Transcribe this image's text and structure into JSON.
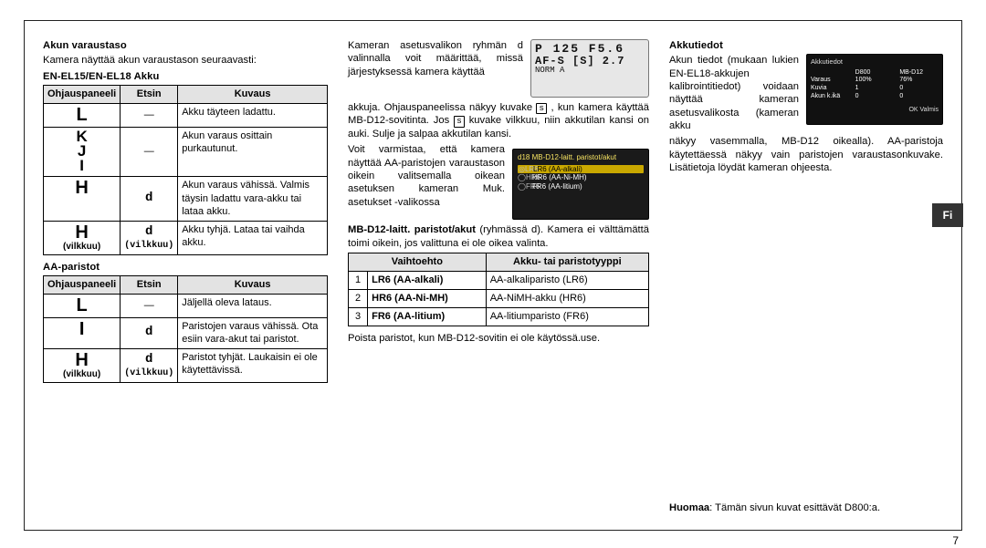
{
  "meta": {
    "page_number": "7",
    "lang_tab": "Fi"
  },
  "col1": {
    "h_level": "Akun varaustaso",
    "level_text": "Kamera näyttää akun varaustason seuraavasti:",
    "h_en": "EN-EL15/EN-EL18 Akku",
    "th_panel": "Ohjauspaneeli",
    "th_finder": "Etsin",
    "th_desc": "Kuvaus",
    "en_rows": [
      {
        "panel": "L",
        "panel_sub": "",
        "finder": "—",
        "finder_sub": "",
        "desc": "Akku täyteen ladattu."
      },
      {
        "panel": "K\nJ\nI",
        "panel_sub": "",
        "finder": "—",
        "finder_sub": "",
        "desc": "Akun varaus osittain purkautunut."
      },
      {
        "panel": "H",
        "panel_sub": "",
        "finder": "d",
        "finder_sub": "",
        "desc": "Akun varaus vähissä. Valmis täysin ladattu vara-akku tai lataa akku."
      },
      {
        "panel": "H",
        "panel_sub": "(vilkkuu)",
        "finder": "d",
        "finder_sub": "(vilkkuu)",
        "desc": "Akku tyhjä. Lataa tai vaihda akku."
      }
    ],
    "h_aa": "AA-paristot",
    "aa_rows": [
      {
        "panel": "L",
        "panel_sub": "",
        "finder": "—",
        "finder_sub": "",
        "desc": "Jäljellä oleva lataus."
      },
      {
        "panel": "I",
        "panel_sub": "",
        "finder": "d",
        "finder_sub": "",
        "desc": "Paristojen varaus vähissä. Ota esiin vara-akut tai paristot."
      },
      {
        "panel": "H",
        "panel_sub": "(vilkkuu)",
        "finder": "d",
        "finder_sub": "(vilkkuu)",
        "desc": "Paristot tyhjät. Laukaisin ei ole käytettävissä."
      }
    ]
  },
  "col2": {
    "p1a": "Kameran asetusvalikon ryhmän d valinnalla voit määrittää, missä järjestyksessä kamera käyttää",
    "p1b_pre": "akkuja. Ohjauspaneelissa näkyy kuvake ",
    "p1b_s1": "s",
    "p1b_mid": " , kun kamera käyttää MB-D12-sovitinta. Jos ",
    "p1b_s2": "s",
    "p1b_post": " kuvake vilkkuu, niin akkutilan kansi on auki. Sulje ja salpaa akkutilan kansi.",
    "p2": "Voit varmistaa, että kamera näyttää AA-paristojen varaustason oikein valitsemalla oikean asetuksen kameran Muk. asetukset -valikossa",
    "p3_pre": "MB-D12-laitt. paristot/akut",
    "p3_post": " (ryhmässä d). Kamera ei välttämättä toimi oikein, jos valittuna ei ole oikea valinta.",
    "th_opt": "Vaihtoehto",
    "th_type": "Akku- tai paristotyyppi",
    "opt_rows": [
      {
        "n": "1",
        "opt": "LR6 (AA-alkali)",
        "type": "AA-alkaliparisto (LR6)"
      },
      {
        "n": "2",
        "opt": "HR6 (AA-Ni-MH)",
        "type": "AA-NiMH-akku (HR6)"
      },
      {
        "n": "3",
        "opt": "FR6 (AA-litium)",
        "type": "AA-litiumparisto (FR6)"
      }
    ],
    "p4": "Poista paristot, kun MB-D12-sovitin ei ole käytössä.use.",
    "lcd": {
      "row1": "P    125  F5.6",
      "row2": "AF-S [S]   2.7",
      "norm": "NORM  A",
      "batt": "▮"
    },
    "menu": {
      "title": "d18 MB-D12-laitt. paristot/akut",
      "l1_a": "◎LR6",
      "l1_b": "LR6 (AA-alkali)",
      "l2_a": "◯HR6",
      "l2_b": "HR6 (AA-Ni-MH)",
      "l3_a": "◯FR6",
      "l3_b": "FR6 (AA-litium)"
    }
  },
  "col3": {
    "h_info": "Akkutiedot",
    "p1": "Akun tiedot (mukaan lukien EN-EL18-akkujen kalibrointitiedot) voidaan näyttää kameran asetusvalikosta (kameran akku",
    "p2": "näkyy vasemmalla, MB-D12 oikealla). AA-paristoja käytettäessä näkyy vain paristojen varaustasonkuvake. Lisätietoja löydät kameran ohjeesta.",
    "info_panel": {
      "title": "Akkutiedot",
      "col_l": "D800",
      "col_r": "MB-D12",
      "row_varaus": "Varaus",
      "v_l": "100%",
      "v_r": "76%",
      "row_kuvia": "Kuvia",
      "k_l": "1",
      "k_r": "0",
      "row_akunika": "Akun k.ikä",
      "i_l": "0",
      "i_r": "0",
      "valmis": "OK Valmis"
    },
    "note_pre": "Huomaa",
    "note_post": ": Tämän sivun kuvat esittävät D800:a."
  }
}
